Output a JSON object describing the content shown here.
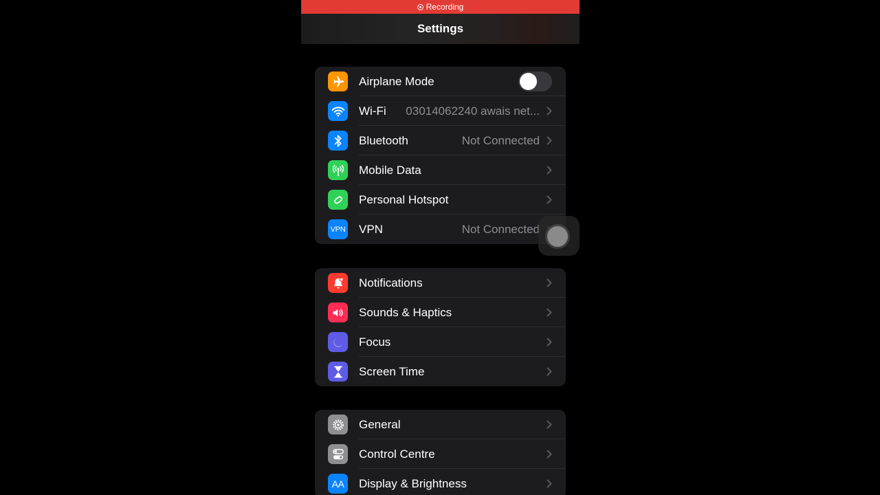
{
  "recording_label": "Recording",
  "title": "Settings",
  "groups": [
    {
      "rows": [
        {
          "label": "Airplane Mode",
          "icon": "airplane-icon",
          "color": "#ff9500",
          "control": "toggle",
          "toggle_on": false
        },
        {
          "label": "Wi-Fi",
          "icon": "wifi-icon",
          "color": "#0a84ff",
          "value": "03014062240 awais net..."
        },
        {
          "label": "Bluetooth",
          "icon": "bluetooth-icon",
          "color": "#0a84ff",
          "value": "Not Connected"
        },
        {
          "label": "Mobile Data",
          "icon": "antenna-icon",
          "color": "#30d158",
          "value": ""
        },
        {
          "label": "Personal Hotspot",
          "icon": "hotspot-icon",
          "color": "#30d158",
          "value": ""
        },
        {
          "label": "VPN",
          "icon": "vpn-icon",
          "icon_text": "VPN",
          "color": "#0a84ff",
          "value": "Not Connected"
        }
      ]
    },
    {
      "rows": [
        {
          "label": "Notifications",
          "icon": "bell-icon",
          "color": "#ff3b30"
        },
        {
          "label": "Sounds & Haptics",
          "icon": "speaker-icon",
          "color": "#ff2d55"
        },
        {
          "label": "Focus",
          "icon": "moon-icon",
          "color": "#5e5ce6"
        },
        {
          "label": "Screen Time",
          "icon": "hourglass-icon",
          "color": "#5e5ce6"
        }
      ]
    },
    {
      "rows": [
        {
          "label": "General",
          "icon": "gear-icon",
          "color": "#8e8e93"
        },
        {
          "label": "Control Centre",
          "icon": "switches-icon",
          "color": "#8e8e93"
        },
        {
          "label": "Display & Brightness",
          "icon": "text-size-icon",
          "icon_text": "AA",
          "color": "#0a84ff"
        }
      ]
    }
  ]
}
